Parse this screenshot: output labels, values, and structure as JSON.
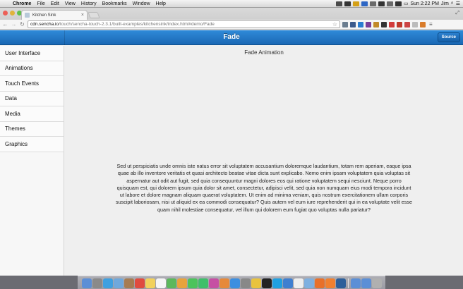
{
  "menubar": {
    "apple": "",
    "app_name": "Chrome",
    "menus": [
      "File",
      "Edit",
      "View",
      "History",
      "Bookmarks",
      "Window",
      "Help"
    ],
    "clock": "Sun 2:22 PM",
    "user": "Jim"
  },
  "browser": {
    "tab_title": "Kitchen Sink",
    "tab_close": "×",
    "url_host": "cdn.sencha.io",
    "url_path": "/touch/sencha-touch-2.3.1/built-examples/kitchensink/index.html#demo/Fade"
  },
  "app": {
    "title": "Fade",
    "source_label": "Source",
    "sidebar": {
      "items": [
        {
          "label": "User Interface"
        },
        {
          "label": "Animations"
        },
        {
          "label": "Touch Events"
        },
        {
          "label": "Data"
        },
        {
          "label": "Media"
        },
        {
          "label": "Themes"
        },
        {
          "label": "Graphics"
        }
      ]
    },
    "content": {
      "title": "Fade Animation",
      "body": "Sed ut perspiciatis unde omnis iste natus error sit voluptatem accusantium doloremque laudantium, totam rem aperiam, eaque ipsa quae ab illo inventore veritatis et quasi architecto beatae vitae dicta sunt explicabo. Nemo enim ipsam voluptatem quia voluptas sit aspernatur aut odit aut fugit, sed quia consequuntur magni dolores eos qui ratione voluptatem sequi nesciunt. Neque porro quisquam est, qui dolorem ipsum quia dolor sit amet, consectetur, adipisci velit, sed quia non numquam eius modi tempora incidunt ut labore et dolore magnam aliquam quaerat voluptatem. Ut enim ad minima veniam, quis nostrum exercitationem ullam corporis suscipit laboriosam, nisi ut aliquid ex ea commodi consequatur? Quis autem vel eum iure reprehenderit qui in ea voluptate velit esse quam nihil molestiae consequatur, vel illum qui dolorem eum fugiat quo voluptas nulla pariatur?"
    }
  },
  "colors": {
    "appbar": "#1f75c4",
    "sidebar_bg": "#f7f7f7",
    "content_bg": "#efefef"
  },
  "dock": {
    "icons": [
      "finder-icon",
      "launchpad-icon",
      "safari-icon",
      "mail-icon",
      "contacts-icon",
      "calendar-icon",
      "notes-icon",
      "reminders-icon",
      "maps-icon",
      "photos-icon",
      "messages-icon",
      "facetime-icon",
      "itunes-icon",
      "ibooks-icon",
      "app-store-icon",
      "system-preferences-icon",
      "chrome-icon",
      "terminal-icon",
      "skype-icon",
      "xcode-icon",
      "textedit-icon",
      "preview-icon",
      "firefox-icon",
      "sublime-icon",
      "photoshop-icon",
      "downloads-icon",
      "documents-icon",
      "trash-icon"
    ]
  }
}
